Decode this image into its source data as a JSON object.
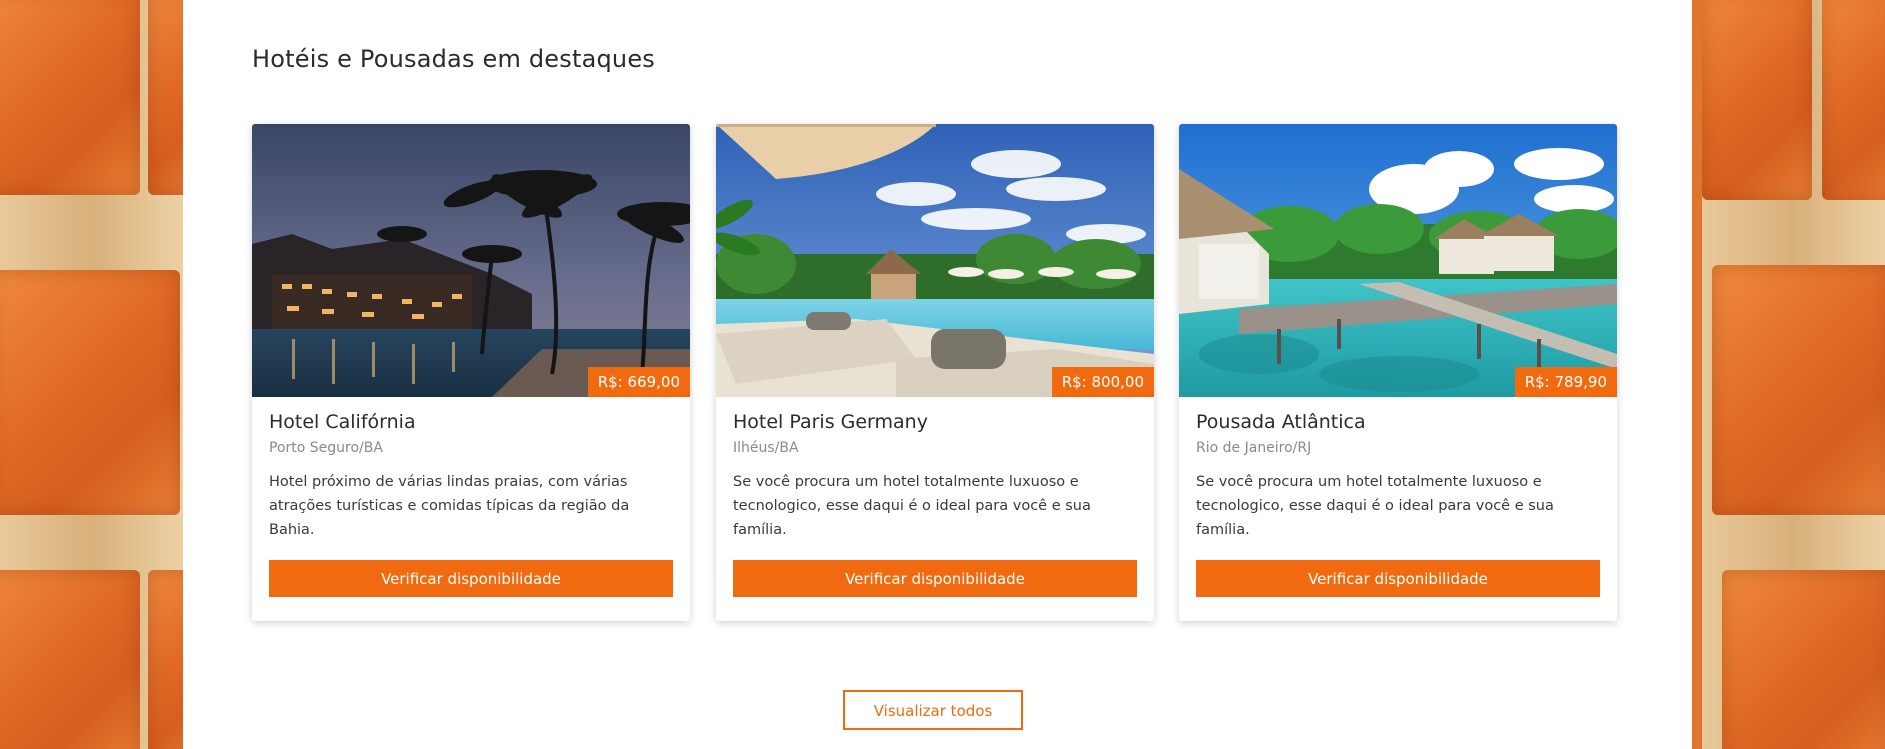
{
  "section": {
    "title": "Hotéis e Pousadas em destaques"
  },
  "cards": [
    {
      "name": "Hotel Califórnia",
      "location": "Porto Seguro/BA",
      "price": "R$: 669,00",
      "description": "Hotel próximo de várias lindas praias, com várias atrações turísticas e comidas típicas da região da Bahia.",
      "cta": "Verificar disponibilidade",
      "image": "night-resort-pool-palms"
    },
    {
      "name": "Hotel Paris Germany",
      "location": "Ilhéus/BA",
      "price": "R$: 800,00",
      "description": "Se você procura um hotel totalmente luxuoso e tecnologico, esse daqui é o ideal para você e sua família.",
      "cta": "Verificar disponibilidade",
      "image": "poolside-loungers-umbrella"
    },
    {
      "name": "Pousada Atlântica",
      "location": "Rio de Janeiro/RJ",
      "price": "R$: 789,90",
      "description": "Se você procura um hotel totalmente luxuoso e tecnologico, esse daqui é o ideal para você e sua família.",
      "cta": "Verificar disponibilidade",
      "image": "overwater-bungalows-pier"
    }
  ],
  "view_all": "Visualizar todos",
  "colors": {
    "accent": "#f26a10",
    "text": "#2b2b2b",
    "muted": "#8a8a8a"
  }
}
